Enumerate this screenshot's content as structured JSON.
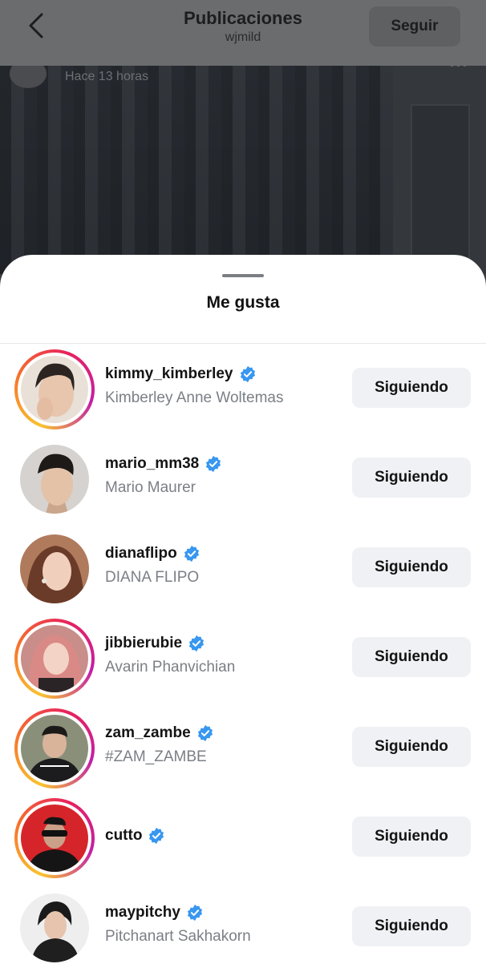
{
  "header": {
    "title": "Publicaciones",
    "subtitle": "wjmild",
    "follow_label": "Seguir"
  },
  "post": {
    "time": "Hace 13 horas"
  },
  "sheet": {
    "title": "Me gusta"
  },
  "likes": [
    {
      "username": "kimmy_kimberley",
      "fullname": "Kimberley Anne Woltemas",
      "verified": true,
      "story_ring": true,
      "button": "Siguiendo"
    },
    {
      "username": "mario_mm38",
      "fullname": "Mario Maurer",
      "verified": true,
      "story_ring": false,
      "button": "Siguiendo"
    },
    {
      "username": "dianaflipo",
      "fullname": "DIANA FLIPO",
      "verified": true,
      "story_ring": false,
      "button": "Siguiendo"
    },
    {
      "username": "jibbierubie",
      "fullname": "Avarin Phanvichian",
      "verified": true,
      "story_ring": true,
      "button": "Siguiendo"
    },
    {
      "username": "zam_zambe",
      "fullname": "#ZAM_ZAMBE",
      "verified": true,
      "story_ring": true,
      "button": "Siguiendo"
    },
    {
      "username": "cutto",
      "fullname": "",
      "verified": true,
      "story_ring": true,
      "button": "Siguiendo"
    },
    {
      "username": "maypitchy",
      "fullname": "Pitchanart Sakhakorn",
      "verified": true,
      "story_ring": false,
      "button": "Siguiendo"
    }
  ],
  "icons": {
    "back": "chevron-left-icon",
    "verified": "verified-badge-icon",
    "more": "more-icon"
  },
  "colors": {
    "verified_blue": "#3897f0",
    "button_bg": "#eff1f4",
    "secondary_text": "#7b7f86"
  }
}
